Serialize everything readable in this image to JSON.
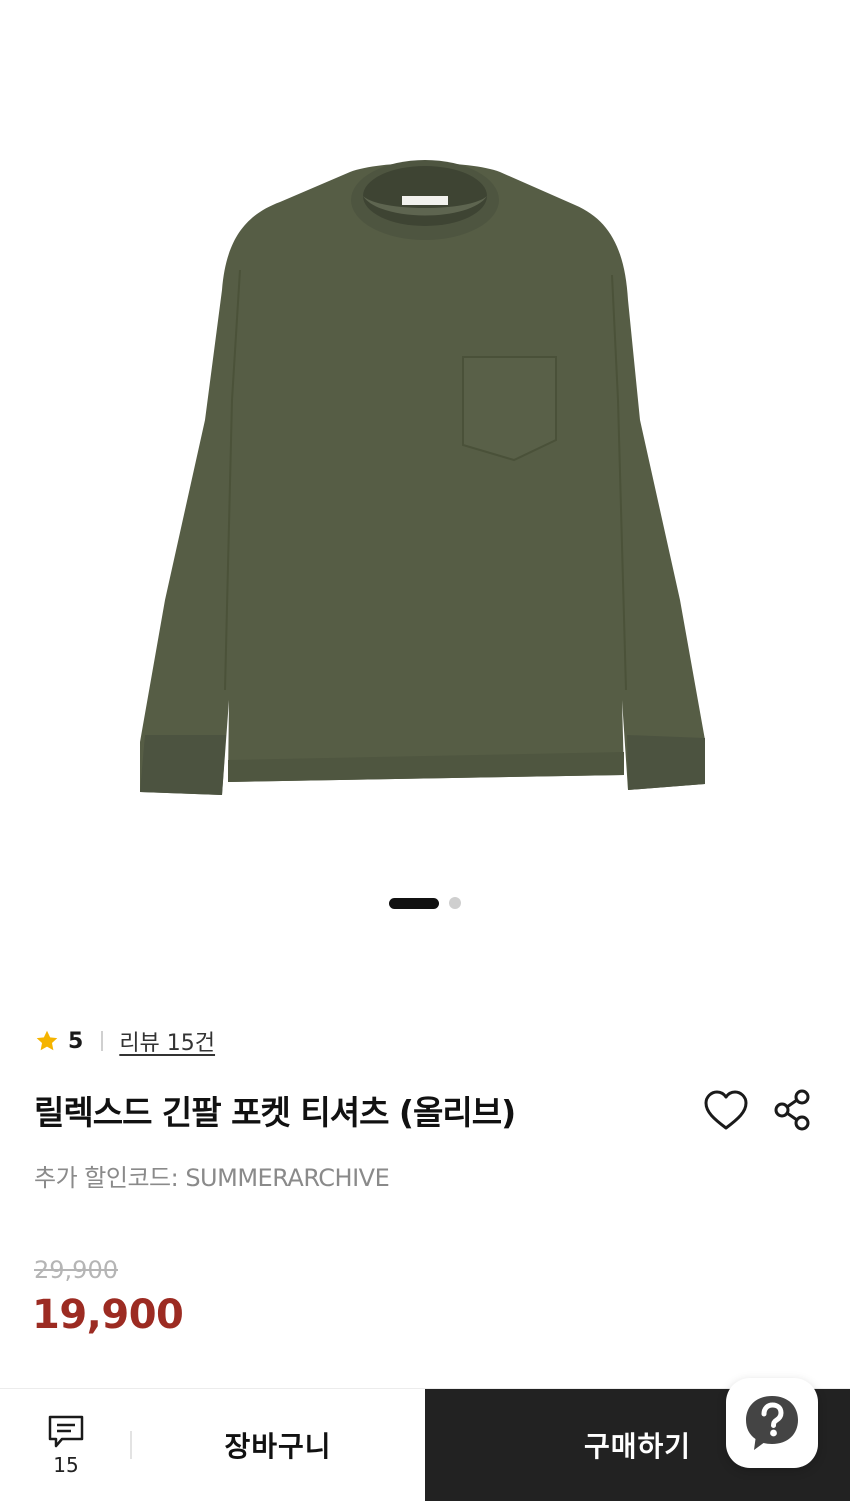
{
  "product": {
    "image_alt": "olive long sleeve pocket t-shirt",
    "carousel": {
      "total": 2,
      "active": 1
    },
    "rating": "5",
    "review_link": "리뷰 15건",
    "title": "릴렉스드 긴팔 포켓 티셔츠 (올리브)",
    "coupon_text": "추가 할인코드: SUMMERARCHIVE",
    "original_price": "29,900",
    "sale_price": "19,900"
  },
  "bottom_bar": {
    "comment_count": "15",
    "cart_label": "장바구니",
    "buy_label": "구매하기"
  },
  "icons": {
    "rating": "star-icon",
    "wishlist": "heart-icon",
    "share": "share-icon",
    "comments": "chat-icon",
    "help": "question-bubble-icon"
  },
  "colors": {
    "shirt": "#565d45",
    "sale_price": "#9c2b22",
    "buy_button": "#222222",
    "star": "#f5b400"
  }
}
